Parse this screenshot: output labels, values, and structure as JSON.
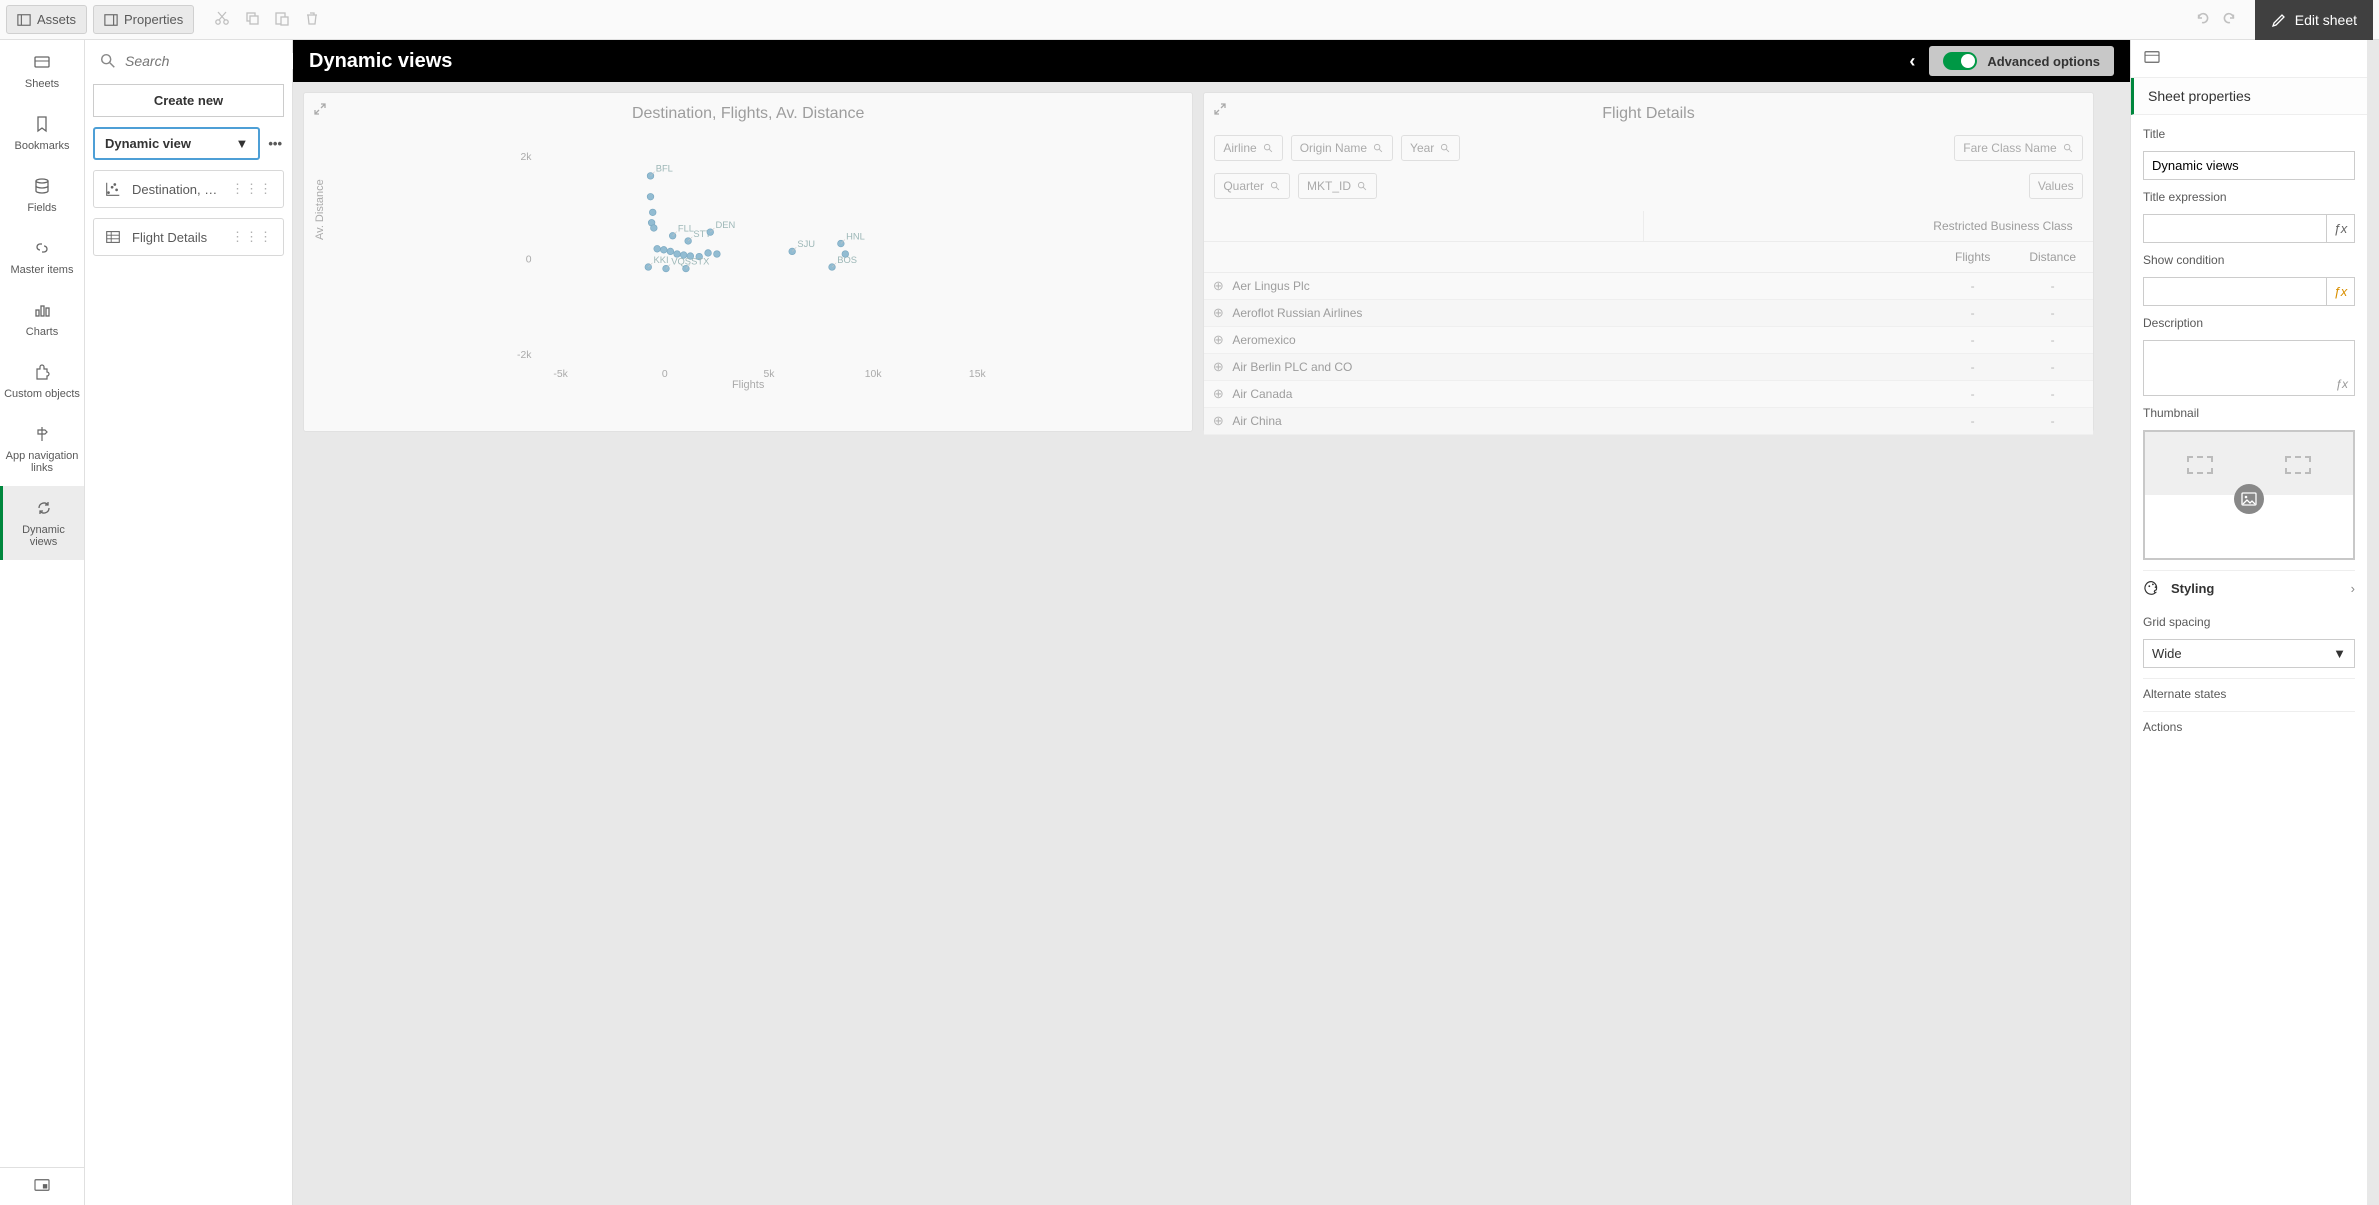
{
  "toolbar": {
    "assets": "Assets",
    "properties": "Properties",
    "edit_sheet": "Edit sheet"
  },
  "rail": {
    "sheets": "Sheets",
    "bookmarks": "Bookmarks",
    "fields": "Fields",
    "master_items": "Master items",
    "charts": "Charts",
    "custom_objects": "Custom objects",
    "app_nav": "App navigation links",
    "dynamic_views": "Dynamic views"
  },
  "assets": {
    "search_placeholder": "Search",
    "create_new": "Create new",
    "dropdown": "Dynamic view",
    "items": [
      {
        "label": "Destination, Fli..."
      },
      {
        "label": "Flight Details"
      }
    ]
  },
  "canvas": {
    "title": "Dynamic views",
    "advanced_options": "Advanced options"
  },
  "viz1": {
    "title": "Destination, Flights, Av. Distance",
    "xlabel": "Flights",
    "ylabel": "Av. Distance",
    "y_ticks": [
      "2k",
      "0",
      "-2k"
    ],
    "x_ticks": [
      "-5k",
      "0",
      "5k",
      "10k",
      "15k"
    ]
  },
  "chart_data": {
    "type": "scatter",
    "title": "Destination, Flights, Av. Distance",
    "xlabel": "Flights",
    "ylabel": "Av. Distance",
    "xlim": [
      -5000,
      15000
    ],
    "ylim": [
      -2000,
      2000
    ],
    "points": [
      {
        "label": "BFL",
        "x": 0,
        "y": 1600
      },
      {
        "label": "",
        "x": 0,
        "y": 1200
      },
      {
        "label": "",
        "x": 100,
        "y": 900
      },
      {
        "label": "",
        "x": 50,
        "y": 700
      },
      {
        "label": "",
        "x": 150,
        "y": 600
      },
      {
        "label": "FLL",
        "x": 1000,
        "y": 450
      },
      {
        "label": "STT",
        "x": 1700,
        "y": 350
      },
      {
        "label": "DEN",
        "x": 2700,
        "y": 520
      },
      {
        "label": "",
        "x": 300,
        "y": 200
      },
      {
        "label": "",
        "x": 600,
        "y": 180
      },
      {
        "label": "",
        "x": 900,
        "y": 150
      },
      {
        "label": "",
        "x": 1200,
        "y": 100
      },
      {
        "label": "",
        "x": 1500,
        "y": 80
      },
      {
        "label": "",
        "x": 1800,
        "y": 60
      },
      {
        "label": "",
        "x": 2200,
        "y": 50
      },
      {
        "label": "",
        "x": 2600,
        "y": 120
      },
      {
        "label": "",
        "x": 3000,
        "y": 100
      },
      {
        "label": "KKI",
        "x": -100,
        "y": -150
      },
      {
        "label": "VQS",
        "x": 700,
        "y": -180
      },
      {
        "label": "STX",
        "x": 1600,
        "y": -180
      },
      {
        "label": "SJU",
        "x": 6400,
        "y": 150
      },
      {
        "label": "HNL",
        "x": 8600,
        "y": 300
      },
      {
        "label": "BOS",
        "x": 8200,
        "y": -150
      },
      {
        "label": "",
        "x": 8800,
        "y": 100
      }
    ]
  },
  "viz2": {
    "title": "Flight Details",
    "filters_row1": [
      "Airline",
      "Origin Name",
      "Year"
    ],
    "filters_row1_right": [
      "Fare Class Name"
    ],
    "filters_row2": [
      "Quarter",
      "MKT_ID"
    ],
    "filters_row2_right": [
      "Values"
    ],
    "restricted_header": "Restricted Business Class",
    "col_flights": "Flights",
    "col_distance": "Distance",
    "rows": [
      {
        "name": "Aer Lingus Plc",
        "flights": "-",
        "distance": "-"
      },
      {
        "name": "Aeroflot Russian Airlines",
        "flights": "-",
        "distance": "-"
      },
      {
        "name": "Aeromexico",
        "flights": "-",
        "distance": "-"
      },
      {
        "name": "Air Berlin PLC and CO",
        "flights": "-",
        "distance": "-"
      },
      {
        "name": "Air Canada",
        "flights": "-",
        "distance": "-"
      },
      {
        "name": "Air China",
        "flights": "-",
        "distance": "-"
      }
    ]
  },
  "props": {
    "header": "Sheet properties",
    "title_label": "Title",
    "title_value": "Dynamic views",
    "title_expr_label": "Title expression",
    "show_cond_label": "Show condition",
    "description_label": "Description",
    "thumbnail_label": "Thumbnail",
    "styling": "Styling",
    "grid_spacing_label": "Grid spacing",
    "grid_spacing_value": "Wide",
    "alt_states": "Alternate states",
    "actions": "Actions"
  }
}
